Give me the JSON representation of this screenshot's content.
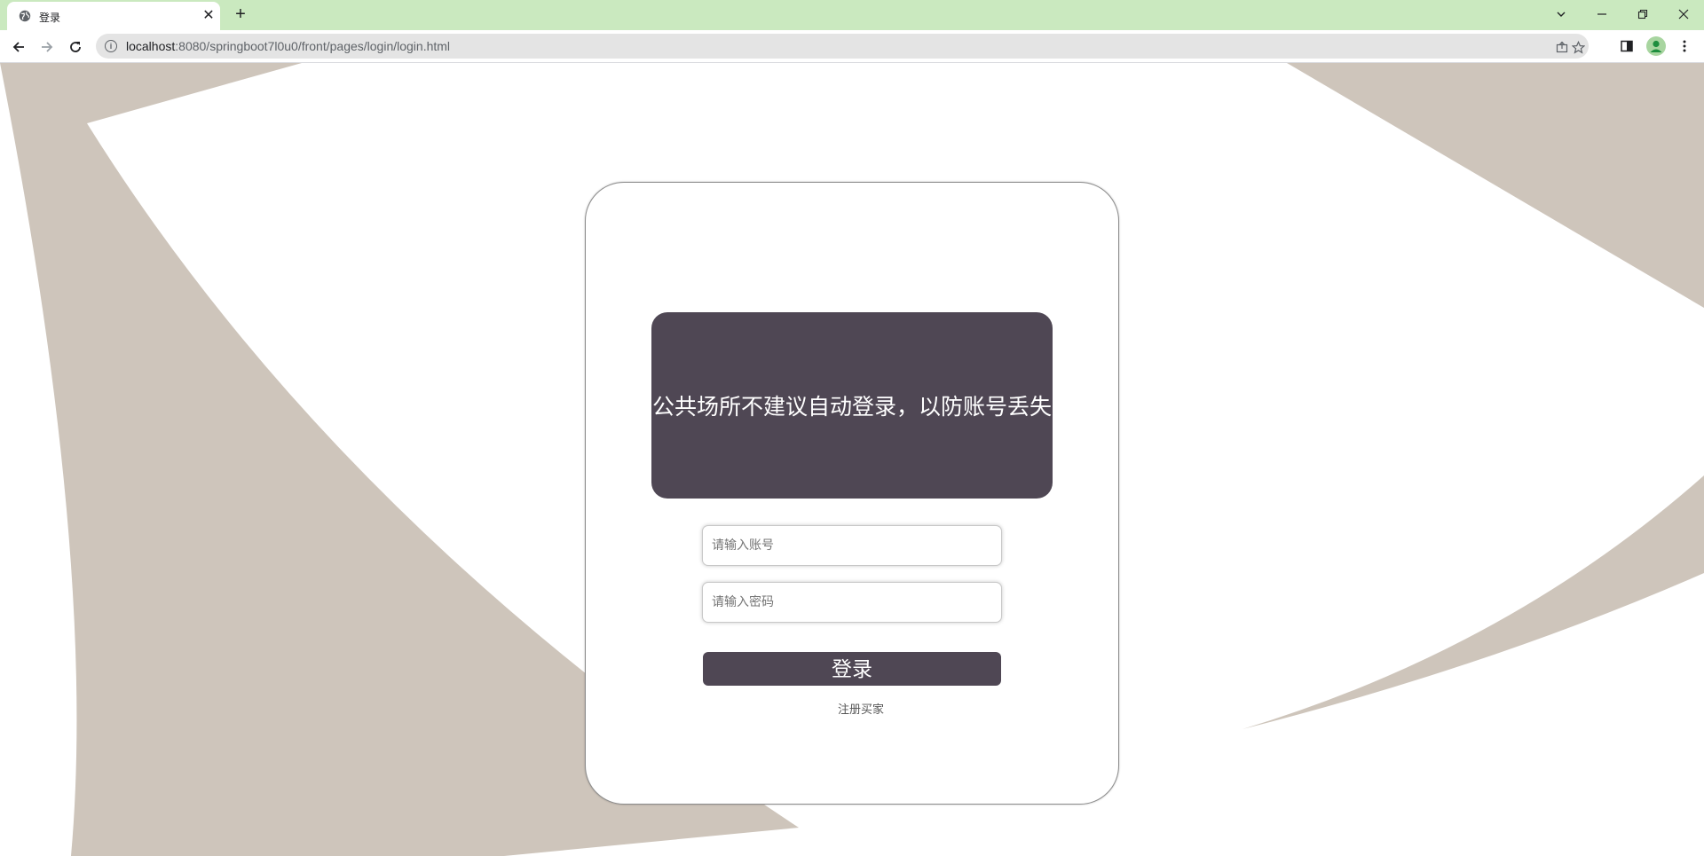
{
  "browser": {
    "tab_title": "登录",
    "tab_close": "✕",
    "new_tab": "+",
    "url_host": "localhost",
    "url_rest": ":8080/springboot7l0u0/front/pages/login/login.html",
    "icons": [
      "globe-icon",
      "back-icon",
      "forward-icon",
      "reload-icon",
      "info-icon",
      "share-icon",
      "bookmark-star-icon",
      "side-panel-icon",
      "profile-icon",
      "menu-icon",
      "minimize-icon",
      "restore-icon",
      "close-icon",
      "tab-search-icon"
    ]
  },
  "colors": {
    "tab_strip": "#cae9bf",
    "background_shape": "#cec5bb",
    "accent": "#4f4754"
  },
  "login": {
    "notice": "公共场所不建议自动登录，以防账号丢失",
    "account_placeholder": "请输入账号",
    "password_placeholder": "请输入密码",
    "submit_label": "登录",
    "register_link": "注册买家"
  }
}
